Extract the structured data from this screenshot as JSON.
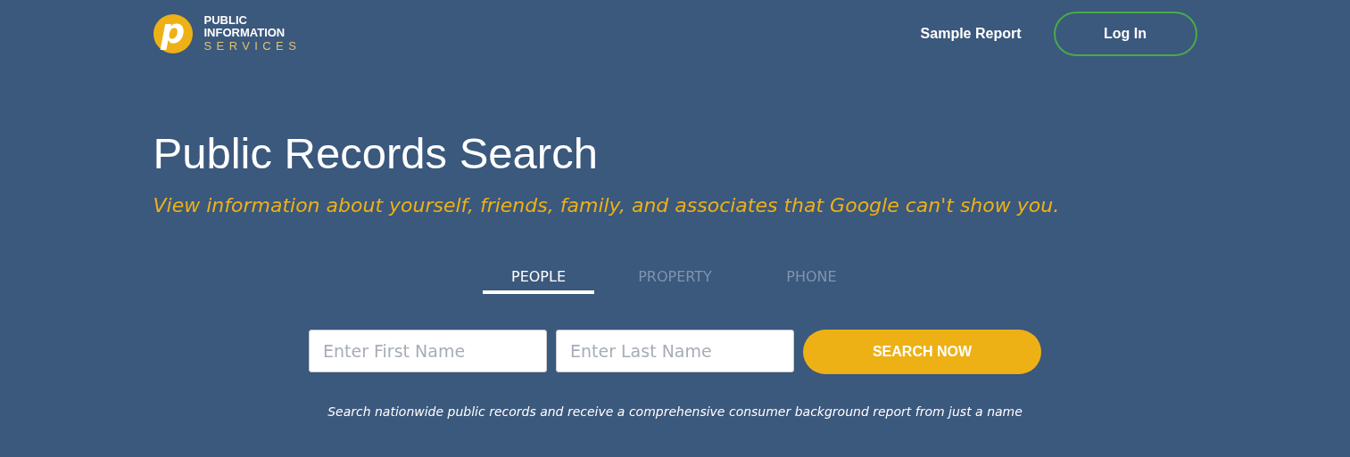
{
  "logo": {
    "mark": "p",
    "line1": "PUBLIC",
    "line2": "INFORMATION",
    "line3": "SERVICES"
  },
  "nav": {
    "link": "Sample Report",
    "login": "Log In"
  },
  "hero": {
    "title": "Public Records Search",
    "subtitle": "View information about yourself, friends, family, and associates that Google can't show you."
  },
  "tabs": [
    {
      "label": "PEOPLE",
      "selected": true
    },
    {
      "label": "PROPERTY",
      "selected": false
    },
    {
      "label": "PHONE",
      "selected": false
    }
  ],
  "search": {
    "first_name": {
      "placeholder": "Enter First Name"
    },
    "last_name": {
      "placeholder": "Enter Last Name"
    },
    "button": "SEARCH NOW"
  },
  "note": "Search nationwide public records and receive a comprehensive consumer background report from just a name"
}
